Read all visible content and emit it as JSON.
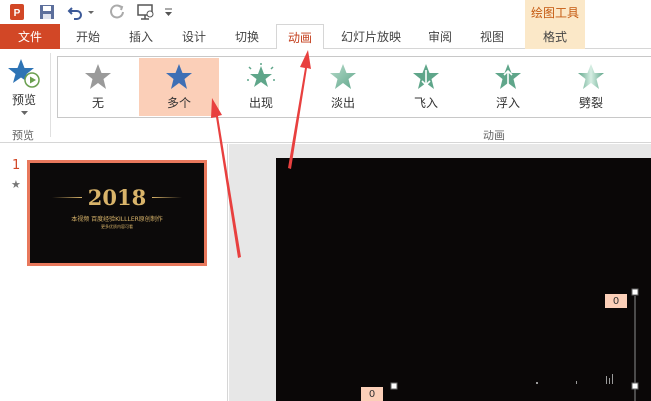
{
  "titlebar": {
    "context_tab_title": "绘图工具"
  },
  "tabs": {
    "file": "文件",
    "home": "开始",
    "insert": "插入",
    "design": "设计",
    "transitions": "切换",
    "animations": "动画",
    "slideshow": "幻灯片放映",
    "review": "审阅",
    "view": "视图",
    "format": "格式"
  },
  "ribbon": {
    "preview_label": "预览",
    "preview_group_label": "预览",
    "animation_group_label": "动画",
    "animations": [
      {
        "label": "无",
        "icon": "star-gray-icon",
        "selected": false
      },
      {
        "label": "多个",
        "icon": "star-blue-icon",
        "selected": true
      },
      {
        "label": "出现",
        "icon": "star-appear-icon",
        "selected": false
      },
      {
        "label": "淡出",
        "icon": "star-fade-icon",
        "selected": false
      },
      {
        "label": "飞入",
        "icon": "star-fly-in-icon",
        "selected": false
      },
      {
        "label": "浮入",
        "icon": "star-float-in-icon",
        "selected": false
      },
      {
        "label": "劈裂",
        "icon": "star-split-icon",
        "selected": false
      }
    ]
  },
  "slides_panel": {
    "slide_number": "1",
    "animation_marker": "★",
    "thumbnail": {
      "year": "2018",
      "subtitle": "本视频 百度经验KILLLER原创制作",
      "small_text": "更多优质内容可看"
    }
  },
  "canvas": {
    "tag_right": "0",
    "tag_bottom": "0"
  },
  "colors": {
    "accent": "#d24726",
    "selection": "#fbcfb8",
    "context_tab": "#fbe8c8",
    "arrow": "#e8403f",
    "thumb_gold": "#d9b46a"
  }
}
